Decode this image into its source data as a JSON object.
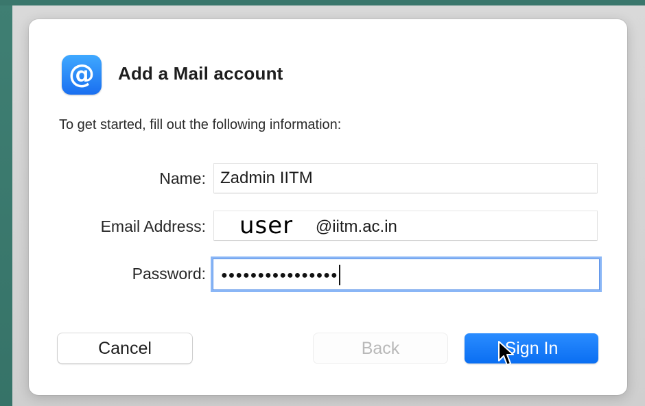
{
  "dialog": {
    "title": "Add a Mail account",
    "icon": "at-sign-icon",
    "instructions": "To get started, fill out the following information:"
  },
  "form": {
    "name_label": "Name:",
    "name_value": "Zadmin IITM",
    "email_label": "Email Address:",
    "email_user": "user",
    "email_domain": "@iitm.ac.in",
    "password_label": "Password:",
    "password_mask": "●●●●●●●●●●●●●●●●"
  },
  "buttons": {
    "cancel": "Cancel",
    "back": "Back",
    "sign_in": "Sign In"
  },
  "colors": {
    "accent": "#0a6ef2",
    "focus_ring": "#8ab6f6",
    "disabled_text": "#b9b9b9"
  }
}
